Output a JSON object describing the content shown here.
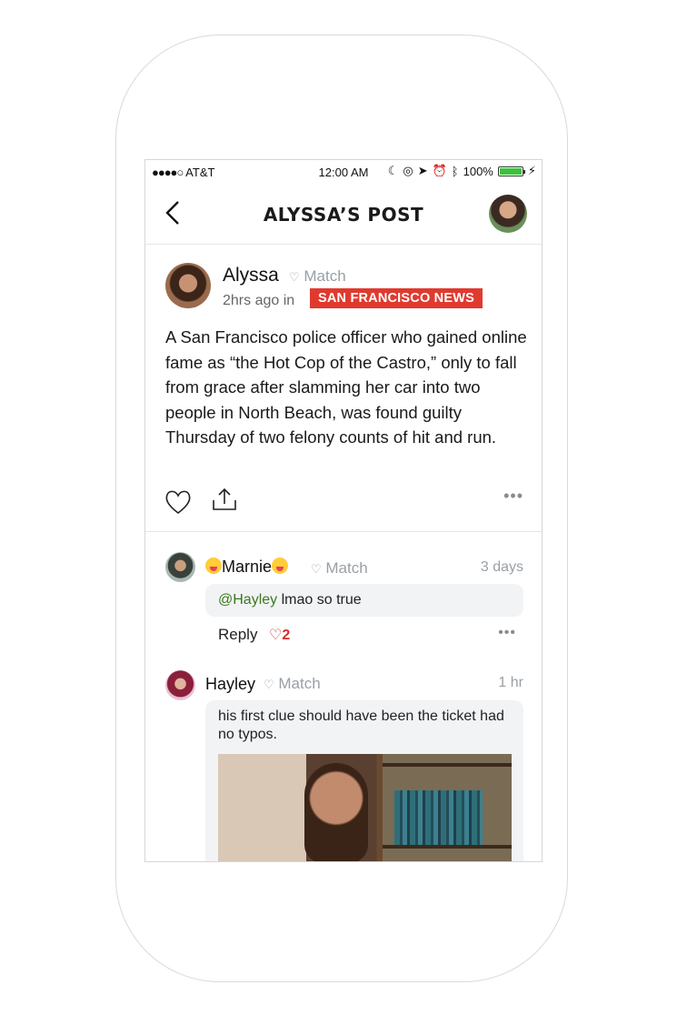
{
  "status_bar": {
    "carrier": "AT&T",
    "time": "12:00 AM",
    "battery": "100%"
  },
  "header": {
    "title": "ALYSSA’S POST"
  },
  "post": {
    "author": "Alyssa",
    "match_label": "Match",
    "time_ago": "2hrs ago in",
    "channel": "SAN FRANCISCO NEWS",
    "body": "A San Francisco police officer who gained online fame as “the Hot Cop of the Castro,” only to fall from grace after slamming her car into two people in North Beach, was found guilty Thursday of two felony counts of hit and run.",
    "more": "•••"
  },
  "comments": [
    {
      "author": "Marnie",
      "match_label": "Match",
      "time": "3 days",
      "mention": "@Hayley",
      "text": " lmao so true",
      "reply_label": "Reply",
      "likes": "2",
      "more": "•••"
    },
    {
      "author": "Hayley",
      "match_label": "Match",
      "time": "1 hr",
      "text": "his first clue should have been the ticket had no typos."
    }
  ],
  "colors": {
    "badge": "#e03a2f",
    "mention": "#3a7a1f",
    "like": "#d02f2a",
    "battery": "#3dc13c"
  }
}
